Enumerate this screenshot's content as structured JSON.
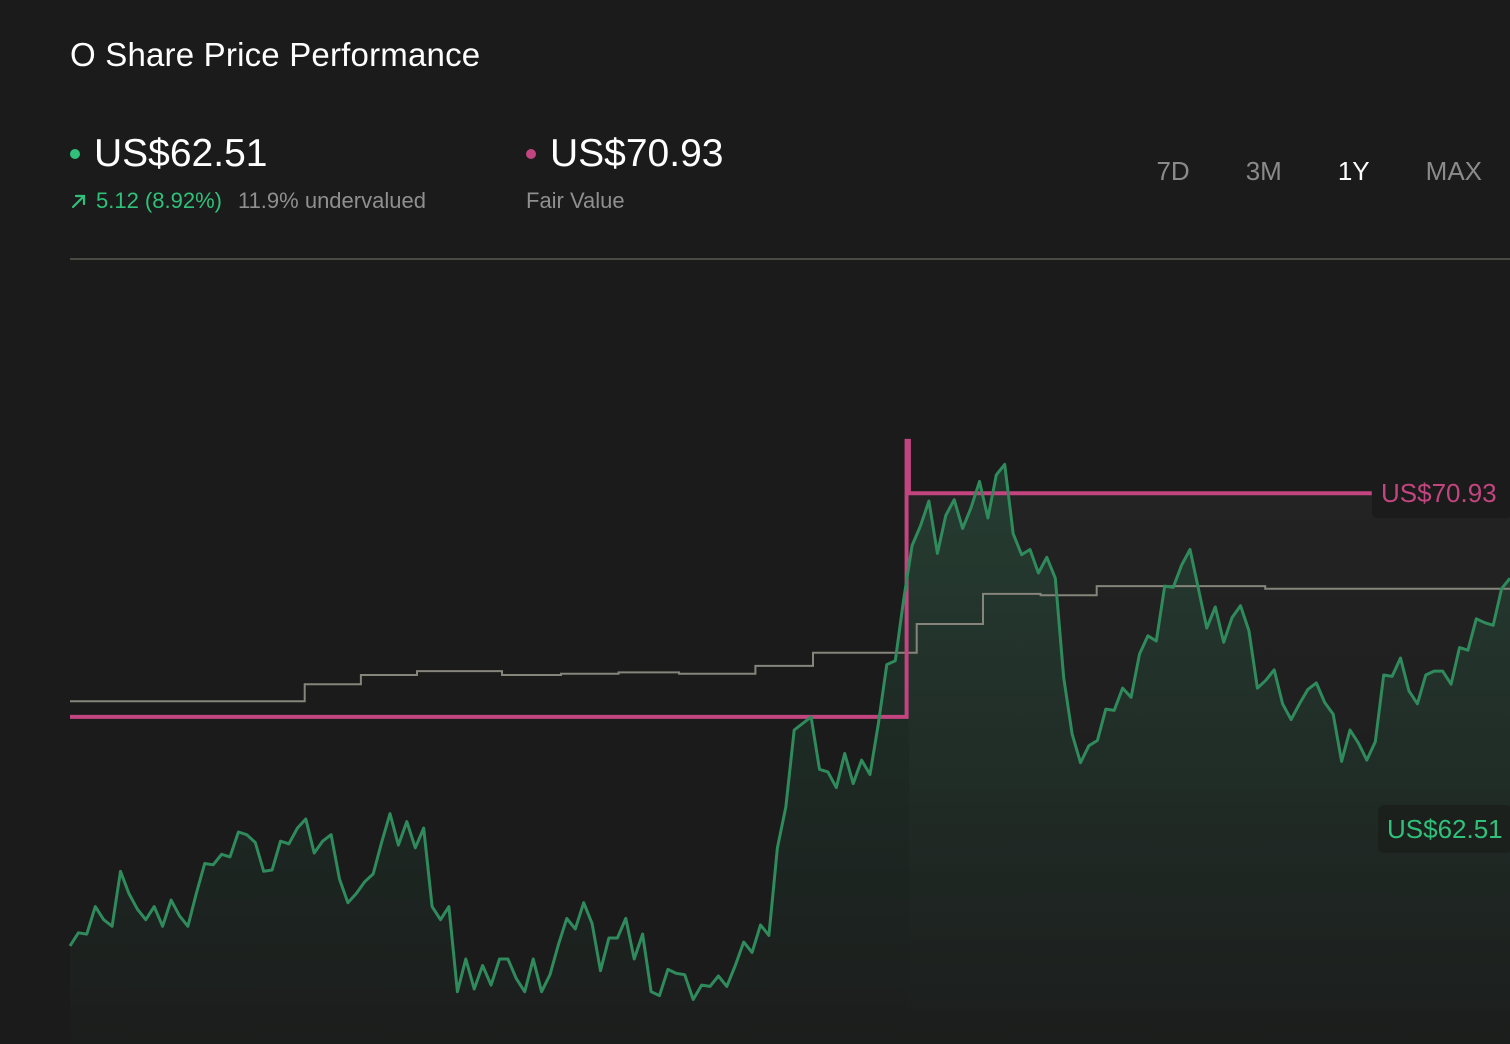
{
  "header": {
    "title": "O Share Price Performance"
  },
  "current_price": {
    "value": "US$62.51",
    "change": "5.12 (8.92%)",
    "valuation": "11.9% undervalued",
    "color": "#2fc17a"
  },
  "fair_value": {
    "value": "US$70.93",
    "label": "Fair Value",
    "color": "#c2457f"
  },
  "tabs": [
    {
      "label": "7D",
      "active": false
    },
    {
      "label": "3M",
      "active": false
    },
    {
      "label": "1Y",
      "active": true
    },
    {
      "label": "MAX",
      "active": false
    }
  ],
  "chart_data": {
    "type": "line",
    "price_label": "US$62.51",
    "fair_value_label": "US$70.93",
    "price_series": [
      47.5,
      48.5,
      48.4,
      50.5,
      49.5,
      49.0,
      53.2,
      51.5,
      50.3,
      49.5,
      50.5,
      49.0,
      51.0,
      49.8,
      49.0,
      51.5,
      53.8,
      53.7,
      54.5,
      54.3,
      56.2,
      56.0,
      55.4,
      53.2,
      53.3,
      55.5,
      55.3,
      56.5,
      57.2,
      54.6,
      55.5,
      56.0,
      52.6,
      50.8,
      51.5,
      52.4,
      53.0,
      55.4,
      57.6,
      55.2,
      57.0,
      55.0,
      56.5,
      50.5,
      49.5,
      50.5,
      44.0,
      46.5,
      44.2,
      46.0,
      44.5,
      46.5,
      46.5,
      45.0,
      44.0,
      46.5,
      44.0,
      45.3,
      47.6,
      49.6,
      48.8,
      50.8,
      49.2,
      45.6,
      48.1,
      48.1,
      49.6,
      46.5,
      48.4,
      44.0,
      43.7,
      45.7,
      45.4,
      45.3,
      43.4,
      44.5,
      44.4,
      45.2,
      44.4,
      46.0,
      47.8,
      47.0,
      49.1,
      48.3,
      55.0,
      58.1,
      64.0,
      64.5,
      65.0,
      61.0,
      60.8,
      59.6,
      62.2,
      59.9,
      61.7,
      60.6,
      64.5,
      69.0,
      69.3,
      74.0,
      78.1,
      79.6,
      81.5,
      77.5,
      80.4,
      81.6,
      79.4,
      81.0,
      83.0,
      80.2,
      83.5,
      84.3,
      79.0,
      77.4,
      77.8,
      76.0,
      77.2,
      75.6,
      68.0,
      63.7,
      61.5,
      62.8,
      63.2,
      65.6,
      65.5,
      67.2,
      66.5,
      69.8,
      71.2,
      70.8,
      75.0,
      74.9,
      76.6,
      77.8,
      74.8,
      71.8,
      73.4,
      70.7,
      72.6,
      73.5,
      71.6,
      67.2,
      67.8,
      68.6,
      66.0,
      64.8,
      66.0,
      67.1,
      67.6,
      66.1,
      65.2,
      61.6,
      64.0,
      63.0,
      61.7,
      63.1,
      68.2,
      68.1,
      69.5,
      67.0,
      66.0,
      68.2,
      68.5,
      68.5,
      67.5,
      70.3,
      70.1,
      72.5,
      72.2,
      72.0,
      74.8,
      75.6
    ],
    "fair_value_steps": [
      {
        "x0": 0.0,
        "x1": 0.581,
        "value": 65.0
      },
      {
        "x0": 0.581,
        "x1": 0.5826,
        "value": 86.1
      },
      {
        "x0": 0.5826,
        "x1": 0.904,
        "value": 82.1
      }
    ],
    "reference_steps": [
      {
        "x0": 0.0,
        "x1": 0.163,
        "value": 66.2
      },
      {
        "x0": 0.163,
        "x1": 0.202,
        "value": 67.5
      },
      {
        "x0": 0.202,
        "x1": 0.241,
        "value": 68.2
      },
      {
        "x0": 0.241,
        "x1": 0.3,
        "value": 68.5
      },
      {
        "x0": 0.3,
        "x1": 0.341,
        "value": 68.2
      },
      {
        "x0": 0.341,
        "x1": 0.381,
        "value": 68.3
      },
      {
        "x0": 0.381,
        "x1": 0.423,
        "value": 68.4
      },
      {
        "x0": 0.423,
        "x1": 0.476,
        "value": 68.3
      },
      {
        "x0": 0.476,
        "x1": 0.516,
        "value": 68.9
      },
      {
        "x0": 0.516,
        "x1": 0.588,
        "value": 69.9
      },
      {
        "x0": 0.588,
        "x1": 0.634,
        "value": 72.1
      },
      {
        "x0": 0.634,
        "x1": 0.674,
        "value": 74.4
      },
      {
        "x0": 0.674,
        "x1": 0.713,
        "value": 74.3
      },
      {
        "x0": 0.713,
        "x1": 0.83,
        "value": 75.0
      },
      {
        "x0": 0.83,
        "x1": 1.0,
        "value": 74.8
      }
    ],
    "ylim": [
      40,
      100
    ],
    "grid": false
  }
}
